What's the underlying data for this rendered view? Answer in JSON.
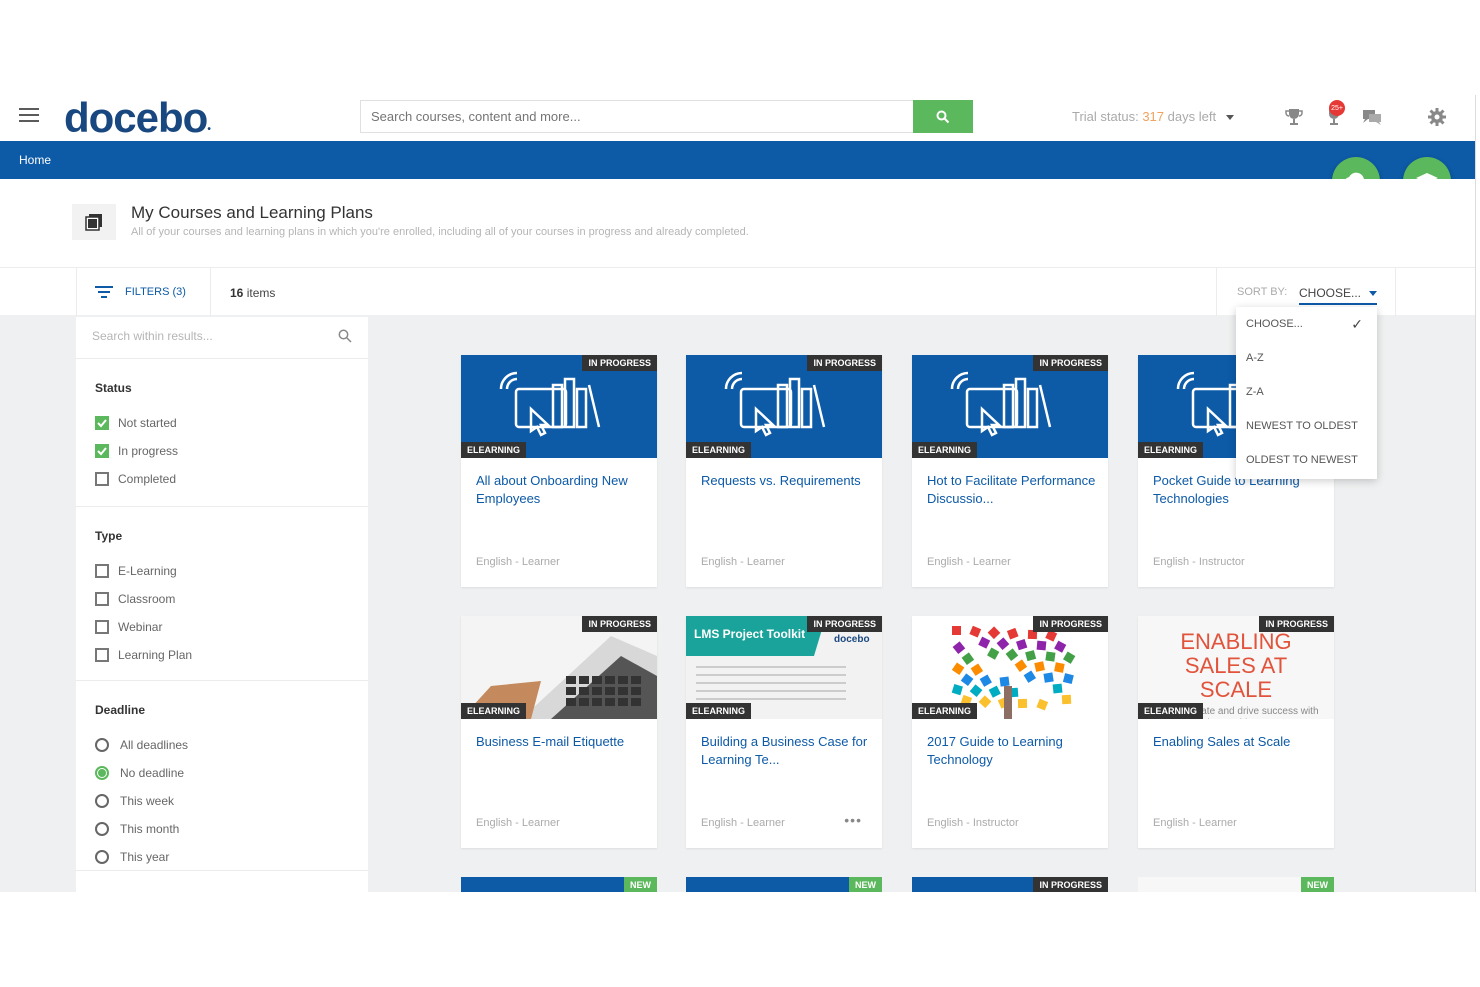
{
  "header": {
    "logo": "docebo",
    "logo_mark": "•",
    "search_placeholder": "Search courses, content and more...",
    "trial_label": "Trial status:",
    "trial_days": "317",
    "trial_suffix": "days left",
    "notification_count": "25+"
  },
  "nav": {
    "home": "Home"
  },
  "page": {
    "title": "My Courses and Learning Plans",
    "subtitle": "All of your courses and learning plans in which you're enrolled, including all of your courses in progress and already completed."
  },
  "toolbar": {
    "filters_label": "FILTERS (3)",
    "items_count": "16",
    "items_label": "items",
    "sort_label": "SORT BY:",
    "sort_value": "CHOOSE..."
  },
  "sort_options": [
    "CHOOSE...",
    "A-Z",
    "Z-A",
    "NEWEST TO OLDEST",
    "OLDEST TO NEWEST"
  ],
  "sidebar": {
    "search_placeholder": "Search within results...",
    "status": {
      "heading": "Status",
      "options": [
        {
          "label": "Not started",
          "checked": true
        },
        {
          "label": "In progress",
          "checked": true
        },
        {
          "label": "Completed",
          "checked": false
        }
      ]
    },
    "type": {
      "heading": "Type",
      "options": [
        {
          "label": "E-Learning",
          "checked": false
        },
        {
          "label": "Classroom",
          "checked": false
        },
        {
          "label": "Webinar",
          "checked": false
        },
        {
          "label": "Learning Plan",
          "checked": false
        }
      ]
    },
    "deadline": {
      "heading": "Deadline",
      "options": [
        {
          "label": "All deadlines",
          "selected": false
        },
        {
          "label": "No deadline",
          "selected": true
        },
        {
          "label": "This week",
          "selected": false
        },
        {
          "label": "This month",
          "selected": false
        },
        {
          "label": "This year",
          "selected": false
        }
      ]
    }
  },
  "courses": [
    {
      "title": "All about Onboarding New Employees",
      "status": "IN PROGRESS",
      "type": "ELEARNING",
      "meta": "English - Learner",
      "thumb": "elearning-icon"
    },
    {
      "title": "Requests vs. Requirements",
      "status": "IN PROGRESS",
      "type": "ELEARNING",
      "meta": "English - Learner",
      "thumb": "elearning-icon"
    },
    {
      "title": "Hot to Facilitate Performance Discussio...",
      "status": "IN PROGRESS",
      "type": "ELEARNING",
      "meta": "English - Learner",
      "thumb": "elearning-icon"
    },
    {
      "title": "Pocket Guide to Learning Technologies",
      "status": "IN PROGRESS",
      "type": "ELEARNING",
      "meta": "English - Instructor",
      "thumb": "elearning-icon"
    },
    {
      "title": "Business E-mail Etiquette",
      "status": "IN PROGRESS",
      "type": "ELEARNING",
      "meta": "English - Learner",
      "thumb": "laptop-photo"
    },
    {
      "title": "Building a Business Case for Learning Te...",
      "status": "IN PROGRESS",
      "type": "ELEARNING",
      "meta": "English - Learner",
      "thumb": "lms-toolkit",
      "thumb_text": "LMS Project Toolkit",
      "thumb_sub": "docebo",
      "has_menu": true
    },
    {
      "title": "2017 Guide to Learning Technology",
      "status": "IN PROGRESS",
      "type": "ELEARNING",
      "meta": "English - Instructor",
      "thumb": "puzzle-tree"
    },
    {
      "title": "Enabling Sales at Scale",
      "status": "IN PROGRESS",
      "type": "ELEARNING",
      "meta": "English - Learner",
      "thumb": "enabling-sales",
      "thumb_text": "ENABLING SALES AT SCALE",
      "thumb_sub": "How to create and drive success with sales enablement"
    }
  ],
  "partial_badges": [
    "NEW",
    "NEW",
    "IN PROGRESS",
    "NEW"
  ],
  "colors": {
    "brand_blue": "#0d5aa7",
    "accent_green": "#5cb85c",
    "logo_navy": "#19477f"
  }
}
